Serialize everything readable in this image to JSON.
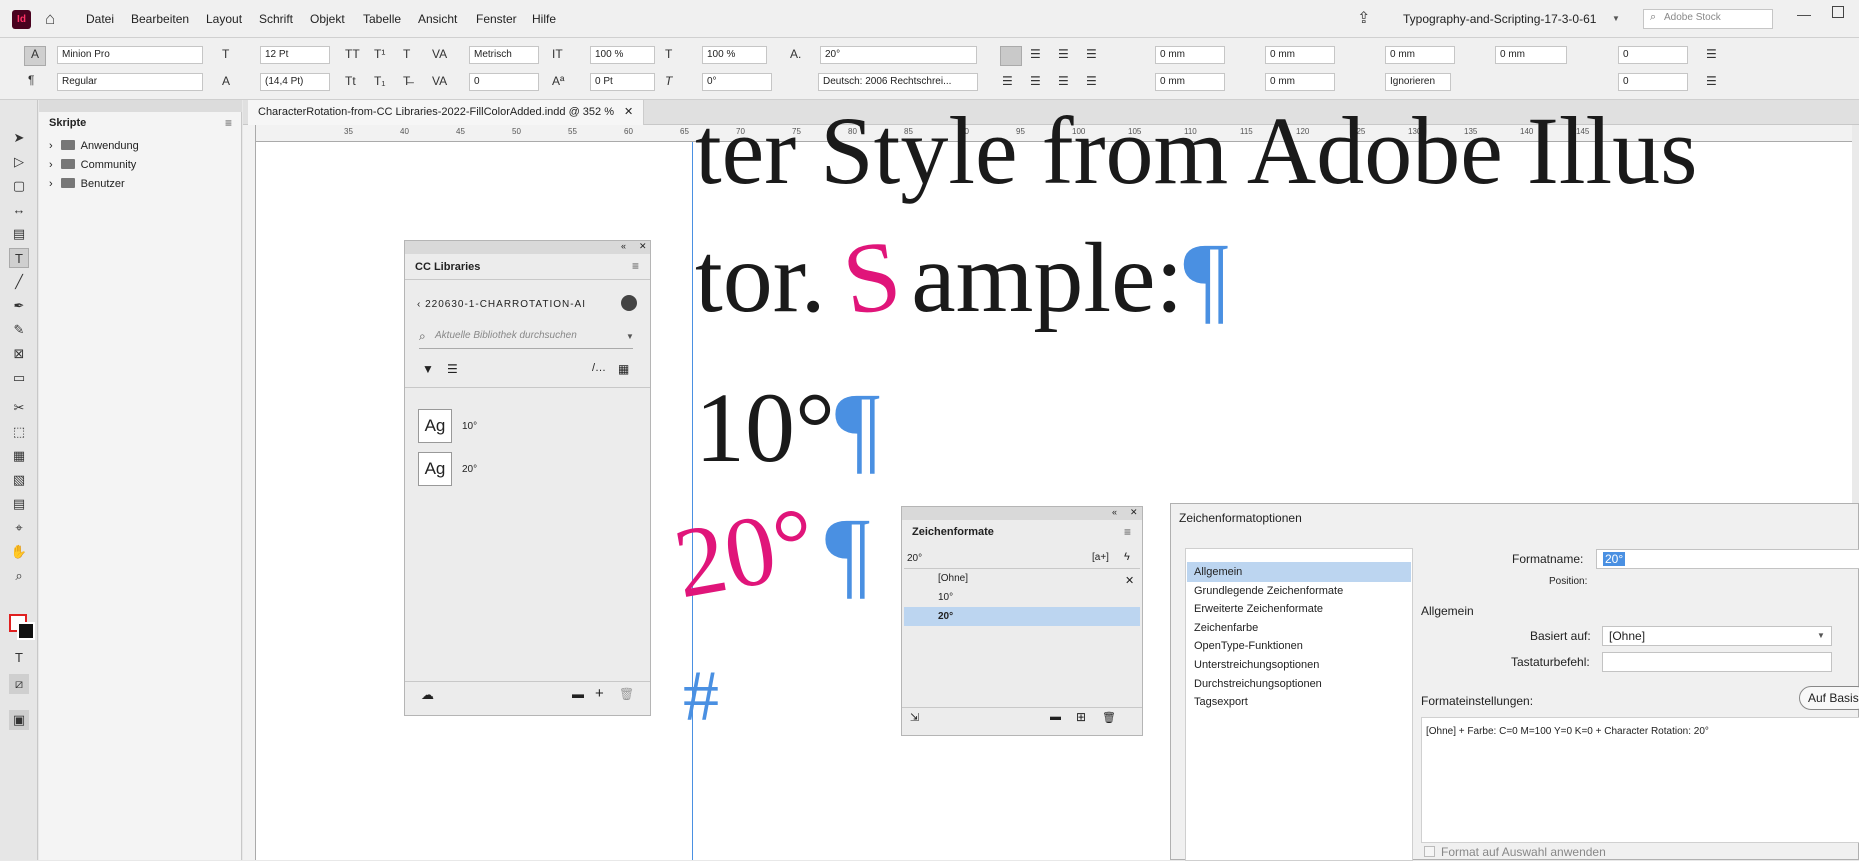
{
  "app": {
    "logo": "Id",
    "menu": [
      "Datei",
      "Bearbeiten",
      "Layout",
      "Schrift",
      "Objekt",
      "Tabelle",
      "Ansicht",
      "Fenster",
      "Hilfe"
    ],
    "workspace": "Typography-and-Scripting-17-3-0-61",
    "stock_placeholder": "Adobe Stock"
  },
  "control": {
    "font_family": "Minion Pro",
    "font_style": "Regular",
    "font_size": "12 Pt",
    "leading": "(14,4 Pt)",
    "kerning": "Metrisch",
    "tracking": "0",
    "vscale": "100 %",
    "hscale": "100 %",
    "baseline": "0 Pt",
    "skew": "0°",
    "rotation": "20°",
    "language": "Deutsch: 2006 Rechtschrei...",
    "indent_left": "0 mm",
    "indent_right": "0 mm",
    "first_line": "0 mm",
    "last_line": "0 mm",
    "space_before": "0 mm",
    "space_after": "0 mm",
    "dropcap_lines": "0",
    "dropcap_chars": "0",
    "ignore": "Ignorieren"
  },
  "skripte": {
    "title": "Skripte",
    "items": [
      "Anwendung",
      "Community",
      "Benutzer"
    ]
  },
  "doc": {
    "tab": "CharacterRotation-from-CC Libraries-2022-FillColorAdded.indd @ 352 %",
    "ruler": [
      "35",
      "40",
      "45",
      "50",
      "55",
      "60",
      "65",
      "70",
      "75",
      "80",
      "85",
      "90",
      "95",
      "100",
      "105",
      "110",
      "115",
      "120",
      "125",
      "130",
      "135",
      "140",
      "145"
    ],
    "line1": "ter Style from Adobe Illus",
    "line2a": "tor.",
    "line2s": "S",
    "line2b": "ample:",
    "pilcrow": "¶",
    "line3": "10°",
    "line4": "20°",
    "hash": "#"
  },
  "cclib": {
    "tab": "CC Libraries",
    "library": "220630-1-CHARROTATION-AI",
    "search_placeholder": "Aktuelle Bibliothek durchsuchen",
    "items": [
      {
        "sample": "Ag",
        "name": "10°"
      },
      {
        "sample": "Ag",
        "name": "20°"
      }
    ]
  },
  "zf": {
    "tab": "Zeichenformate",
    "current": "20°",
    "items": [
      "[Ohne]",
      "10°",
      "20°"
    ],
    "selected": 2
  },
  "dlg": {
    "title": "Zeichenformatoptionen",
    "nav": [
      "Allgemein",
      "Grundlegende Zeichenformate",
      "Erweiterte Zeichenformate",
      "Zeichenfarbe",
      "OpenType-Funktionen",
      "Unterstreichungsoptionen",
      "Durchstreichungsoptionen",
      "Tagsexport"
    ],
    "name_label": "Formatname:",
    "name_value": "20°",
    "position_label": "Position:",
    "section": "Allgemein",
    "based_label": "Basiert auf:",
    "based_value": "[Ohne]",
    "shortcut_label": "Tastaturbefehl:",
    "settings_label": "Formateinstellungen:",
    "reset_button": "Auf Basis",
    "summary": "[Ohne] + Farbe: C=0 M=100 Y=0 K=0 + Character Rotation:  20°",
    "apply_label": "Format auf Auswahl anwenden"
  }
}
